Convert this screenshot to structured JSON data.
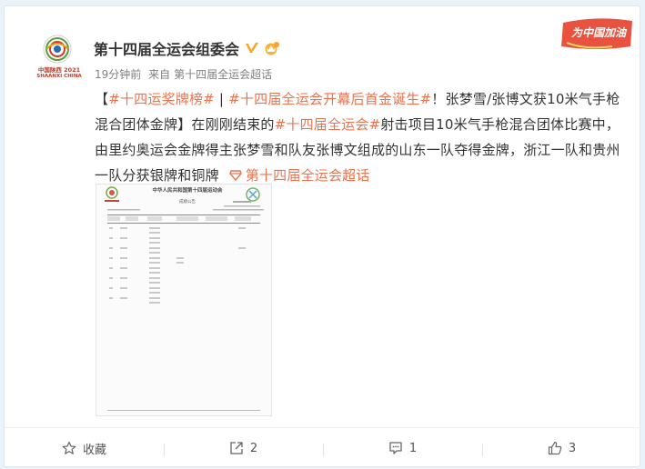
{
  "post": {
    "author": "第十四届全运会组委会",
    "time": "19分钟前",
    "source_prefix": "来自",
    "source": "第十四届全运会超话",
    "cheer_badge": "为中国加油",
    "logo_text": "中国陕西 2021",
    "logo_subtext": "SHAANXI CHINA",
    "content": {
      "bracket_open": "【",
      "tag1": "#十四运奖牌榜#",
      "sep": " | ",
      "tag2": "#十四届全运会开幕后首金诞生#",
      "text1": "！张梦雪/张博文获10米气手枪混合团体金牌】在刚刚结束的",
      "tag3": "#十四届全运会#",
      "text2": "射击项目10米气手枪混合团体比赛中，由里约奥运会金牌得主张梦雪和队友张博文组成的山东一队夺得金牌，浙江一队和贵州一队分获银牌和铜牌 ",
      "supertopic": "第十四届全运会超话"
    },
    "image": {
      "title": "中华人民共和国第十四届运动会",
      "subtitle": "成绩公告"
    }
  },
  "actions": {
    "favorite": "收藏",
    "share": "2",
    "comment": "1",
    "like": "3"
  },
  "colors": {
    "accent": "#eb7350",
    "verified": "#f6a623",
    "background": "#eaf3f9"
  },
  "icons": [
    "star-icon",
    "share-icon",
    "comment-icon",
    "like-icon",
    "verified-icon",
    "crown-icon",
    "supertopic-icon"
  ]
}
